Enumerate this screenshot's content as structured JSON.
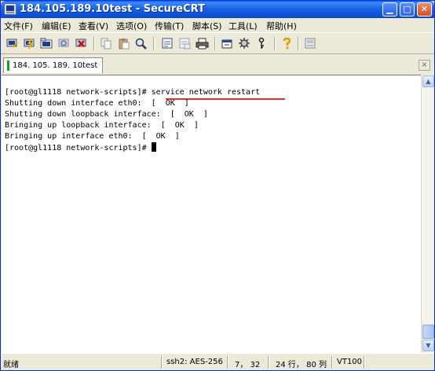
{
  "window": {
    "title": "184.105.189.10test - SecureCRT"
  },
  "menu": [
    "文件(F)",
    "编辑(E)",
    "查看(V)",
    "选项(O)",
    "传输(T)",
    "脚本(S)",
    "工具(L)",
    "帮助(H)"
  ],
  "toolbar": {
    "icons": [
      "connect-icon",
      "quick-connect-icon",
      "connect-in-tab-icon",
      "reconnect-icon",
      "disconnect-icon",
      "copy-icon",
      "paste-icon",
      "find-icon",
      "sftp-icon",
      "print-icon",
      "print-setup-icon",
      "session-options-icon",
      "global-options-icon",
      "keymap-icon",
      "help-icon",
      "about-icon"
    ]
  },
  "tab": {
    "label": "184. 105. 189. 10test",
    "close": "×"
  },
  "terminal": {
    "lines": [
      "",
      "[root@gl1118 network-scripts]# service network restart",
      "Shutting down interface eth0:  [  OK  ]",
      "Shutting down loopback interface:  [  OK  ]",
      "Bringing up loopback interface:  [  OK  ]",
      "Bringing up interface eth0:  [  OK  ]",
      "[root@gl1118 network-scripts]# "
    ]
  },
  "status": {
    "ready": "就绪",
    "cipher": "ssh2: AES-256",
    "position": "7， 32",
    "size": "24 行， 80 列",
    "emulation": "VT100"
  },
  "colors": {
    "title_bar": "#0a4fd6",
    "accent_underline": "#e03030",
    "tab_marker": "#1da01d"
  }
}
